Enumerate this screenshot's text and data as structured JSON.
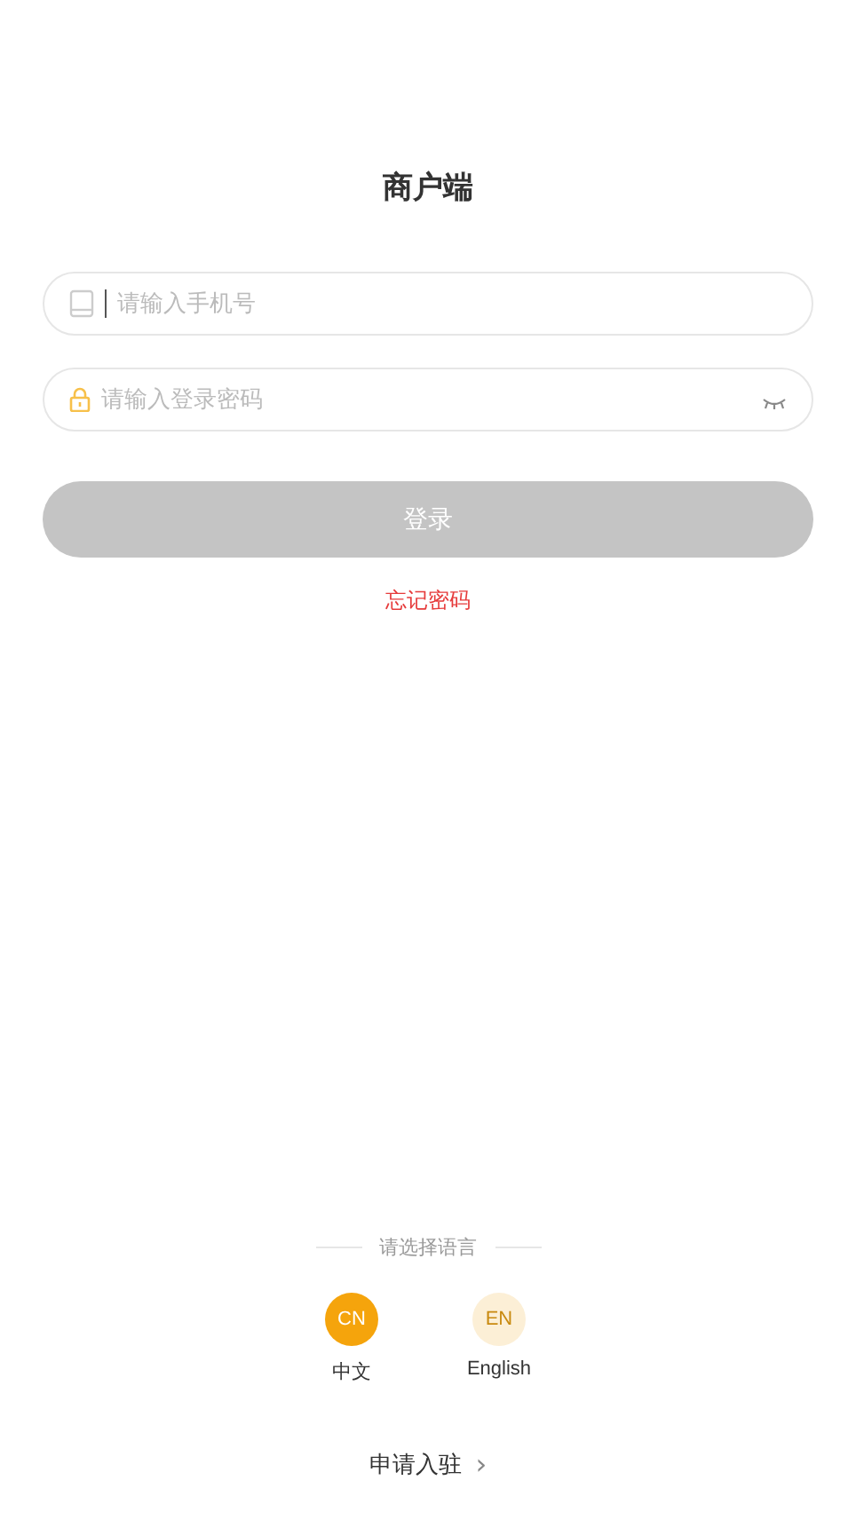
{
  "title": "商户端",
  "phone_field": {
    "placeholder": "请输入手机号",
    "focused": true
  },
  "password_field": {
    "placeholder": "请输入登录密码",
    "visible": false
  },
  "login_button": {
    "label": "登录",
    "disabled": true
  },
  "forgot_password": "忘记密码",
  "language": {
    "heading": "请选择语言",
    "options": [
      {
        "badge": "CN",
        "label": "中文",
        "selected": true
      },
      {
        "badge": "EN",
        "label": "English",
        "selected": false
      }
    ]
  },
  "apply_link": {
    "label": "申请入驻",
    "arrow": "›"
  }
}
